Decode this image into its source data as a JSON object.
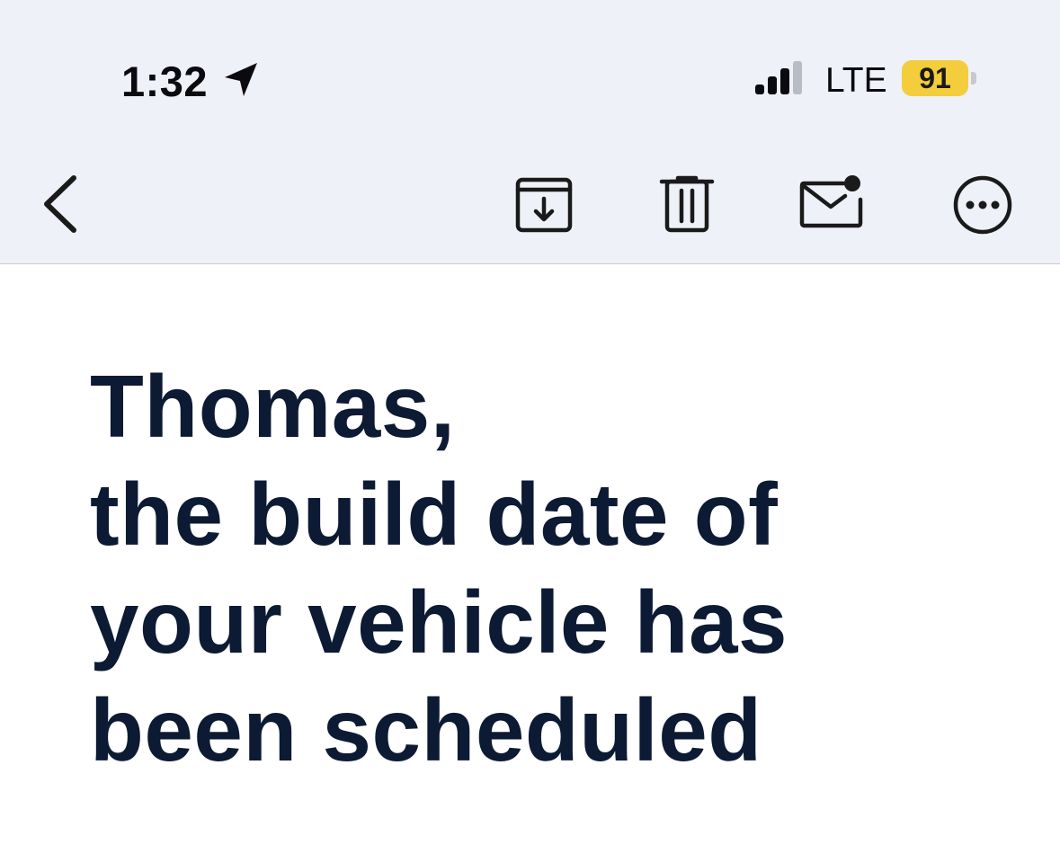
{
  "status_bar": {
    "time": "1:32",
    "location_icon": "location-arrow-icon",
    "signal_icon": "cellular-signal-icon",
    "network": "LTE",
    "battery_level": "91",
    "battery_color": "#f4cd3d"
  },
  "toolbar": {
    "background": "#eef1f7",
    "icons": [
      "chevron-left-icon",
      "archive-icon",
      "trash-icon",
      "mail-unread-icon",
      "more-icon"
    ]
  },
  "message": {
    "headline_lines": [
      "Thomas,",
      "the build date of",
      "your vehicle has",
      "been scheduled"
    ],
    "text_color": "#0c1a33"
  }
}
